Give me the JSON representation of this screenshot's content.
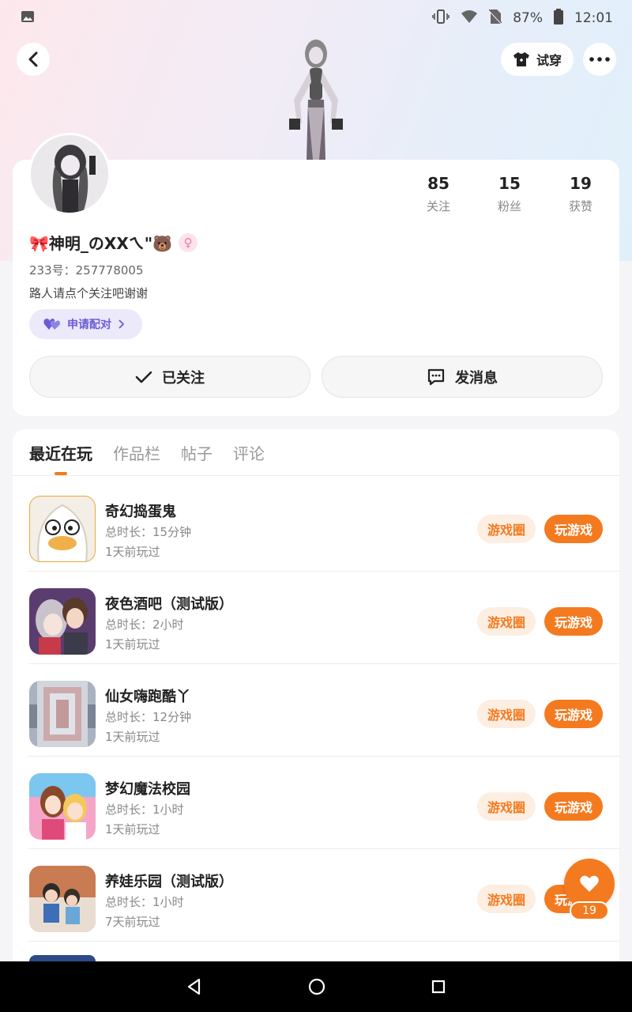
{
  "status_bar": {
    "battery": "87%",
    "time": "12:01"
  },
  "header": {
    "try_on_label": "试穿"
  },
  "profile": {
    "username": "🎀神明_のXXㄟ\"🐻",
    "uid": "233号：257778005",
    "bio": "路人请点个关注吧谢谢",
    "pair_label": "申请配对",
    "stats": [
      {
        "value": "85",
        "label": "关注"
      },
      {
        "value": "15",
        "label": "粉丝"
      },
      {
        "value": "19",
        "label": "获赞"
      }
    ],
    "follow_label": "已关注",
    "message_label": "发消息"
  },
  "tabs": [
    {
      "label": "最近在玩",
      "active": true
    },
    {
      "label": "作品栏",
      "active": false
    },
    {
      "label": "帖子",
      "active": false
    },
    {
      "label": "评论",
      "active": false
    }
  ],
  "games": [
    {
      "name": "奇幻捣蛋鬼",
      "duration": "总时长：15分钟",
      "last_played": "1天前玩过",
      "circle_label": "游戏圈",
      "play_label": "玩游戏"
    },
    {
      "name": "夜色酒吧（测试版）",
      "duration": "总时长：2小时",
      "last_played": "1天前玩过",
      "circle_label": "游戏圈",
      "play_label": "玩游戏"
    },
    {
      "name": "仙女嗨跑酷丫",
      "duration": "总时长：12分钟",
      "last_played": "1天前玩过",
      "circle_label": "游戏圈",
      "play_label": "玩游戏"
    },
    {
      "name": "梦幻魔法校园",
      "duration": "总时长：1小时",
      "last_played": "1天前玩过",
      "circle_label": "游戏圈",
      "play_label": "玩游戏"
    },
    {
      "name": "养娃乐园（测试版）",
      "duration": "总时长：1小时",
      "last_played": "7天前玩过",
      "circle_label": "游戏圈",
      "play_label": "玩游戏"
    }
  ],
  "fab": {
    "count": "19"
  },
  "colors": {
    "accent": "#f47a1f",
    "pair": "#6b5cd6"
  }
}
